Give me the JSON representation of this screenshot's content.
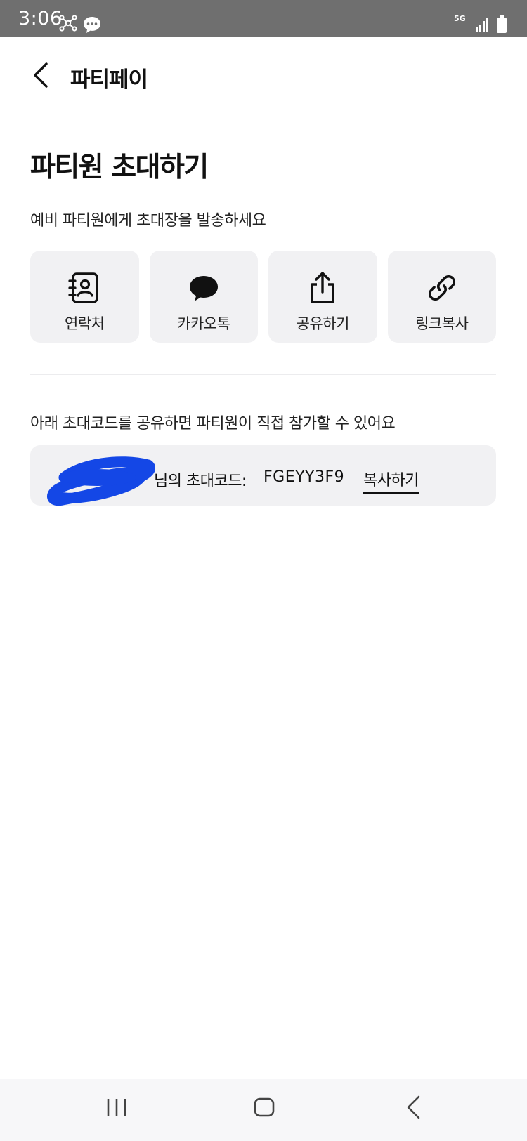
{
  "status_bar": {
    "time": "3:06",
    "network": "5G",
    "icons": [
      "hub-icon",
      "chat-bubble-icon",
      "5g-icon",
      "signal-icon",
      "battery-icon"
    ]
  },
  "header": {
    "back_icon": "chevron-left-icon",
    "title": "파티페이"
  },
  "invite": {
    "title": "파티원 초대하기",
    "subtitle": "예비 파티원에게 초대장을 발송하세요",
    "share_options": [
      {
        "label": "연락처",
        "icon": "contacts-icon"
      },
      {
        "label": "카카오톡",
        "icon": "kakaotalk-icon"
      },
      {
        "label": "공유하기",
        "icon": "share-icon"
      },
      {
        "label": "링크복사",
        "icon": "link-icon"
      }
    ]
  },
  "code_section": {
    "description": "아래 초대코드를 공유하면 파티원이 직접 참가할 수 있어요",
    "owner_label": "님의 초대코드:",
    "code": "FGEYY3F9",
    "copy_label": "복사하기"
  },
  "nav_bar": {
    "icons": [
      "recent-apps-icon",
      "home-icon",
      "back-icon"
    ]
  },
  "colors": {
    "status_bar_bg": "#6f6f6f",
    "card_bg": "#f1f1f3",
    "text": "#111111",
    "redaction": "#1447e6"
  }
}
